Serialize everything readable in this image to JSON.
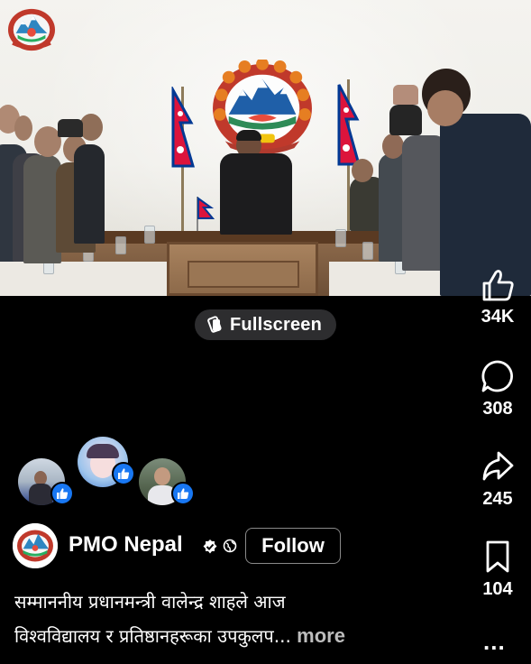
{
  "video": {
    "description_icons": [
      "nepal-emblem",
      "nepal-flag"
    ]
  },
  "fullscreen": {
    "label": "Fullscreen"
  },
  "actions": {
    "like": {
      "icon": "thumbs-up-icon",
      "count": "34K"
    },
    "comment": {
      "icon": "comment-bubble-icon",
      "count": "308"
    },
    "share": {
      "icon": "share-arrow-icon",
      "count": "245"
    },
    "save": {
      "icon": "bookmark-icon",
      "count": "104"
    },
    "more": "..."
  },
  "author": {
    "name": "PMO Nepal",
    "follow_label": "Follow"
  },
  "caption": {
    "line1": "सम्माननीय प्रधानमन्त्री वालेन्द्र शाहले आज",
    "line2": "विश्वविद्यालय र प्रतिष्ठानहरूका उपकुलप...",
    "more_label": "more"
  },
  "colors": {
    "background": "#000000",
    "like_blue": "#1877f2",
    "chip_bg": "#2d2d2f",
    "flag_red": "#dc143c",
    "flag_blue": "#003893"
  }
}
